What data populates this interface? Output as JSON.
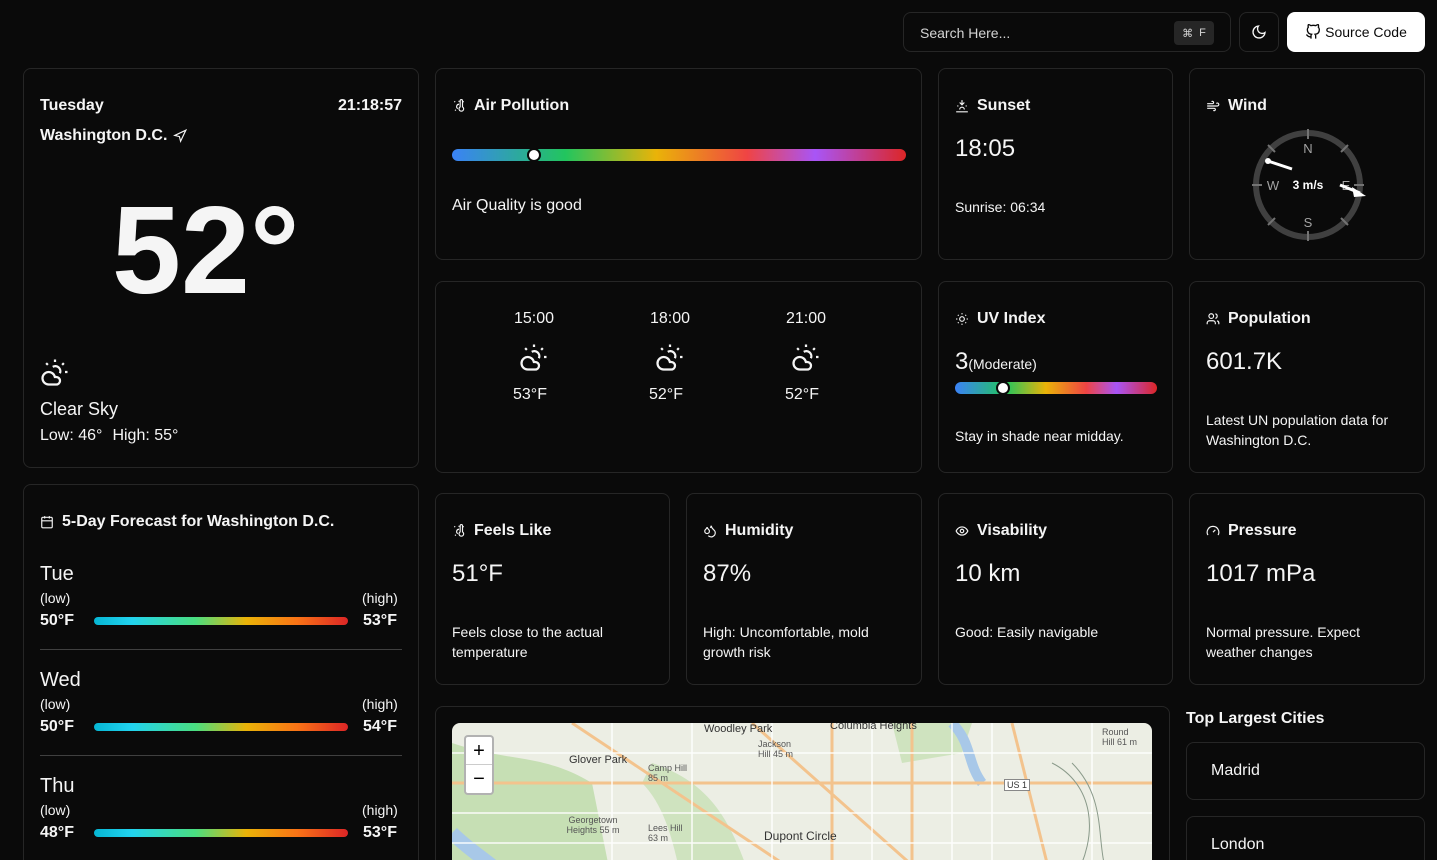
{
  "search": {
    "placeholder": "Search Here...",
    "shortcut_symbol": "⌘",
    "shortcut_key": "F"
  },
  "header": {
    "source_label": "Source Code"
  },
  "current": {
    "day": "Tuesday",
    "time": "21:18:57",
    "city": "Washington D.C.",
    "temp": "52°",
    "condition": "Clear Sky",
    "low": "Low: 46°",
    "high": "High: 55°"
  },
  "air_pollution": {
    "title": "Air Pollution",
    "text": "Air Quality is good",
    "level": 0.18
  },
  "sunset": {
    "title": "Sunset",
    "time": "18:05",
    "sunrise": "Sunrise: 06:34"
  },
  "wind": {
    "title": "Wind",
    "speed": "3 m/s",
    "n": "N",
    "s": "S",
    "e": "E",
    "w": "W"
  },
  "hourly": [
    {
      "time": "15:00",
      "temp": "53°F"
    },
    {
      "time": "18:00",
      "temp": "52°F"
    },
    {
      "time": "21:00",
      "temp": "52°F"
    }
  ],
  "uv": {
    "title": "UV Index",
    "value": "3",
    "label": "(Moderate)",
    "text": "Stay in shade near midday.",
    "level": 0.24
  },
  "population": {
    "title": "Population",
    "value": "601.7K",
    "text": "Latest UN population data for Washington D.C."
  },
  "feels_like": {
    "title": "Feels Like",
    "value": "51°F",
    "text": "Feels close to the actual temperature"
  },
  "humidity": {
    "title": "Humidity",
    "value": "87%",
    "text": "High: Uncomfortable, mold growth risk"
  },
  "visibility": {
    "title": "Visability",
    "value": "10 km",
    "text": "Good: Easily navigable"
  },
  "pressure": {
    "title": "Pressure",
    "value": "1017 mPa",
    "text": "Normal pressure. Expect weather changes"
  },
  "forecast": {
    "title": "5-Day Forecast for Washington D.C.",
    "low_label": "(low)",
    "high_label": "(high)",
    "days": [
      {
        "day": "Tue",
        "low": "50°F",
        "high": "53°F"
      },
      {
        "day": "Wed",
        "low": "50°F",
        "high": "54°F"
      },
      {
        "day": "Thu",
        "low": "48°F",
        "high": "53°F"
      }
    ]
  },
  "map": {
    "zoom_in": "+",
    "zoom_out": "−",
    "labels": [
      "Woodley Park",
      "Columbia Heights",
      "Glover Park",
      "Camp Hill 85 m",
      "Jackson Hill 45 m",
      "Round Hill 61 m",
      "US 1",
      "Georgetown Heights 55 m",
      "Lees Hill 63 m",
      "Dupont Circle"
    ]
  },
  "cities": {
    "title": "Top Largest Cities",
    "items": [
      "Madrid",
      "London"
    ]
  },
  "colors": {
    "bg": "#0a0a0a",
    "border": "#262626",
    "text": "#f5f5f5"
  }
}
